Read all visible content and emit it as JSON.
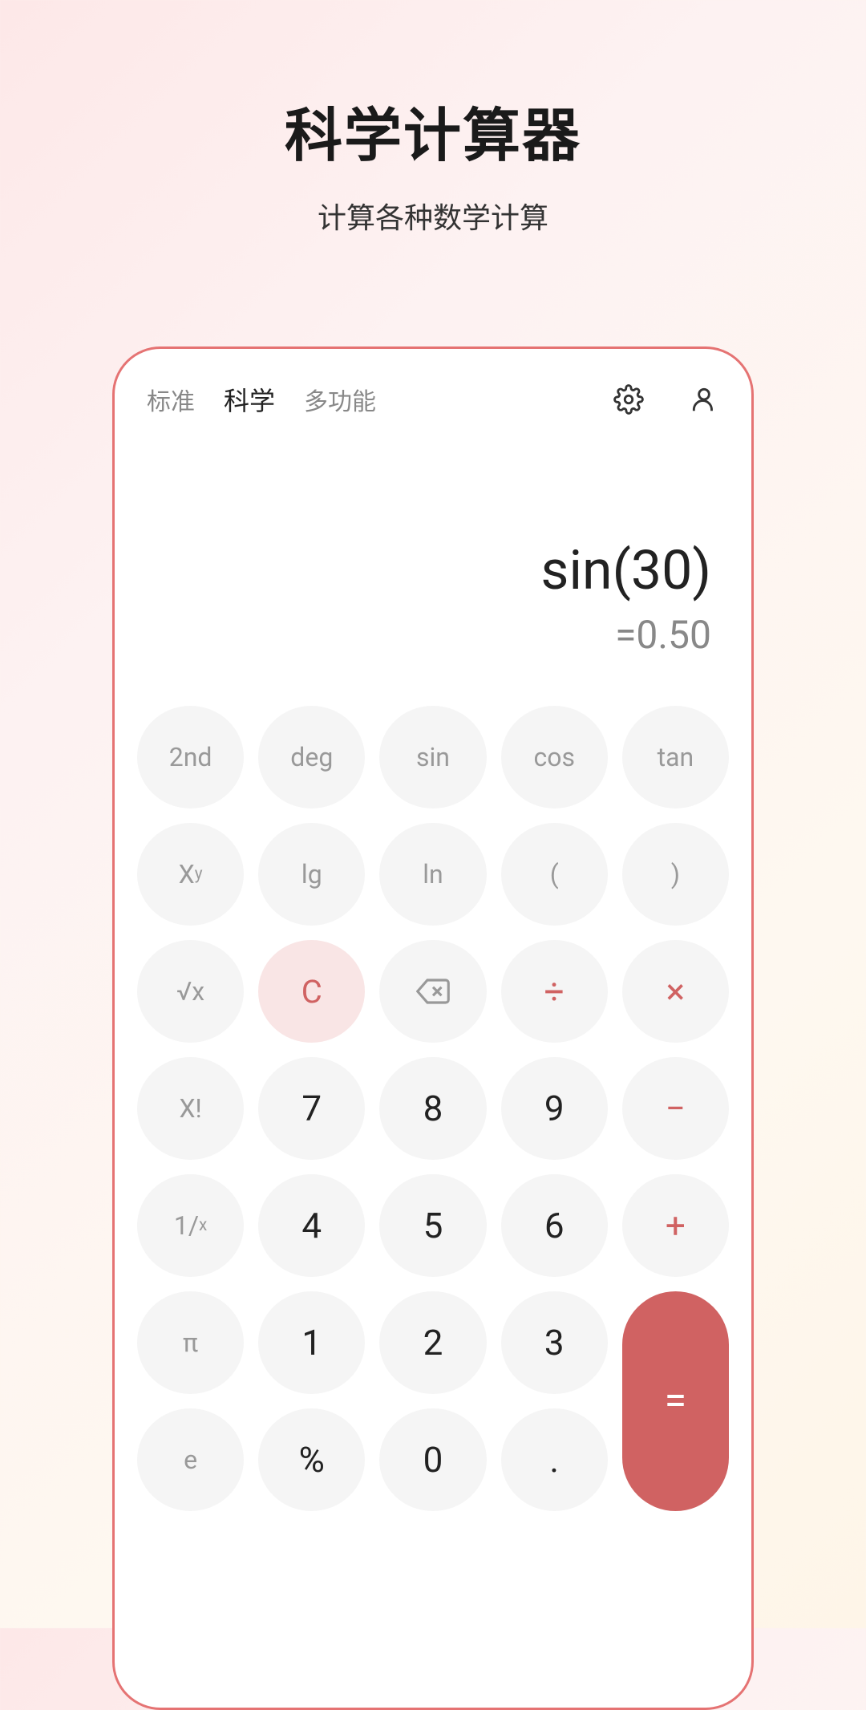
{
  "page": {
    "title": "科学计算器",
    "subtitle": "计算各种数学计算"
  },
  "tabs": {
    "standard": "标准",
    "scientific": "科学",
    "multi": "多功能"
  },
  "display": {
    "expression": "sin(30)",
    "result": "=0.50"
  },
  "keys": {
    "r0": {
      "k0": "2nd",
      "k1": "deg",
      "k2": "sin",
      "k3": "cos",
      "k4": "tan"
    },
    "r1": {
      "k0_base": "X",
      "k0_sup": "y",
      "k1": "lg",
      "k2": "ln",
      "k3": "(",
      "k4": ")"
    },
    "r2": {
      "k0": "√x",
      "k1": "C",
      "k3": "÷",
      "k4": "×"
    },
    "r3": {
      "k0": "X!",
      "k1": "7",
      "k2": "8",
      "k3": "9",
      "k4": "−"
    },
    "r4": {
      "k0_num": "1",
      "k0_den": "x",
      "k1": "4",
      "k2": "5",
      "k3": "6",
      "k4": "+"
    },
    "r5": {
      "k0": "π",
      "k1": "1",
      "k2": "2",
      "k3": "3"
    },
    "r6": {
      "k0": "e",
      "k1": "%",
      "k2": "0",
      "k3": "."
    },
    "equals": "="
  }
}
